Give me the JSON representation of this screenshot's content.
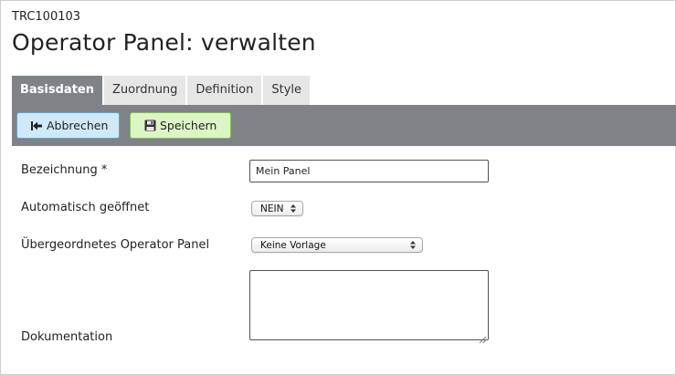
{
  "header": {
    "record_id": "TRC100103",
    "title": "Operator Panel: verwalten"
  },
  "tabs": [
    {
      "label": "Basisdaten",
      "active": true
    },
    {
      "label": "Zuordnung",
      "active": false
    },
    {
      "label": "Definition",
      "active": false
    },
    {
      "label": "Style",
      "active": false
    }
  ],
  "toolbar": {
    "cancel_label": "Abbrechen",
    "save_label": "Speichern",
    "background": "#7f8388"
  },
  "form": {
    "name_label": "Bezeichnung *",
    "name_value": "Mein Panel",
    "auto_open_label": "Automatisch geöffnet",
    "auto_open_value": "NEIN",
    "parent_label": "Übergeordnetes Operator Panel",
    "parent_value": "Keine Vorlage",
    "doc_label": "Dokumentation",
    "doc_value": ""
  },
  "colors": {
    "cancel_bg": "#cfe9f9",
    "cancel_border": "#5aa7d6",
    "save_bg": "#dcf5c4",
    "save_border": "#82c04f",
    "active_tab": "#7f8388"
  },
  "icons": {
    "cancel": "back-to-start-icon",
    "save": "floppy-disk-icon"
  }
}
